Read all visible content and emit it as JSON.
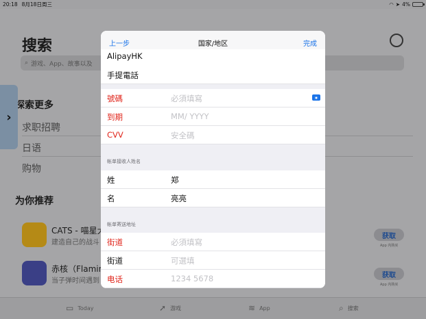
{
  "status_bar": {
    "time": "20:18",
    "date": "8月18日周三",
    "battery": "4%"
  },
  "background": {
    "title": "搜索",
    "search_placeholder": "游戏、App、故事以及",
    "explore_heading": "探索更多",
    "explore_links": [
      "求职招聘",
      "日语",
      "购物"
    ],
    "for_you_heading": "为你推荐",
    "apps": [
      {
        "name": "CATS - 喵星大",
        "subtitle": "建造自己的战斗",
        "get_label": "获取",
        "iap_note": "App 内购买"
      },
      {
        "name": "赤核（Flamin",
        "subtitle": "当子弹时间遇到",
        "get_label": "获取",
        "iap_note": "App 内购买"
      }
    ],
    "tabs": [
      {
        "label": "Today",
        "icon": "today-icon"
      },
      {
        "label": "游戏",
        "icon": "rocket-icon"
      },
      {
        "label": "App",
        "icon": "stack-icon"
      },
      {
        "label": "搜索",
        "icon": "search-icon"
      }
    ]
  },
  "sheet": {
    "nav": {
      "back": "上一步",
      "title": "国家/地区",
      "done": "完成"
    },
    "payment_methods": [
      "AlipayHK",
      "手提電話"
    ],
    "card_fields": [
      {
        "label": "號碼",
        "placeholder": "必須填寫"
      },
      {
        "label": "到期",
        "placeholder": "MM/ YYYY"
      },
      {
        "label": "CVV",
        "placeholder": "安全碼"
      }
    ],
    "billing_name_header": "帐单接收人姓名",
    "name_fields": [
      {
        "label": "姓",
        "value": "郑"
      },
      {
        "label": "名",
        "value": "亮亮"
      }
    ],
    "billing_address_header": "帐单寄送地址",
    "address_fields": [
      {
        "label": "街道",
        "placeholder": "必須填寫",
        "required": true
      },
      {
        "label": "街道",
        "placeholder": "可選填",
        "required": false
      },
      {
        "label": "电话",
        "placeholder": "1234 5678",
        "required": true
      }
    ]
  },
  "colors": {
    "accent": "#1a73e8",
    "required_label": "#e0251b"
  }
}
